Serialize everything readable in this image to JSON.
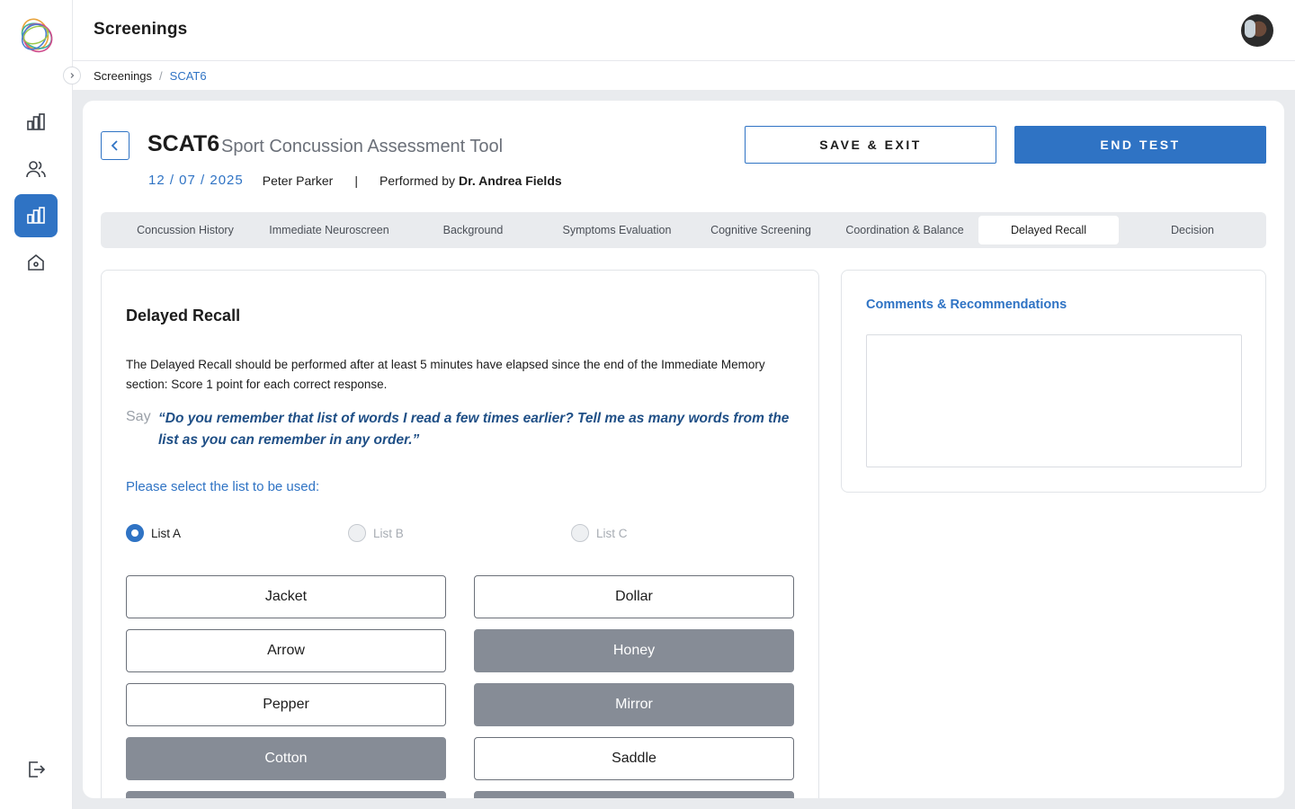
{
  "header": {
    "title": "Screenings"
  },
  "breadcrumb": {
    "root": "Screenings",
    "separator": "/",
    "current": "SCAT6"
  },
  "sidebar": {
    "items": [
      {
        "icon": "bar-chart-icon"
      },
      {
        "icon": "users-icon"
      },
      {
        "icon": "bar-chart-icon",
        "active": true
      },
      {
        "icon": "home-icon"
      }
    ],
    "logout_icon": "logout-icon"
  },
  "test": {
    "code": "SCAT6",
    "name": "Sport Concussion Assessment Tool",
    "date": "12 / 07 / 2025",
    "patient": "Peter Parker",
    "divider": "|",
    "performed_by_label": "Performed by",
    "doctor": "Dr. Andrea Fields"
  },
  "actions": {
    "save_exit": "SAVE & EXIT",
    "end_test": "END TEST"
  },
  "tabs": [
    "Concussion History",
    "Immediate Neuroscreen",
    "Background",
    "Symptoms Evaluation",
    "Cognitive Screening",
    "Coordination & Balance",
    "Delayed Recall",
    "Decision"
  ],
  "active_tab": "Delayed Recall",
  "delayed_recall": {
    "title": "Delayed Recall",
    "instructions": "The Delayed Recall should be performed after at least 5 minutes have elapsed since the end of the Immediate Memory section: Score 1 point for each correct response.",
    "say_label": "Say",
    "say_text": "“Do you remember that list of words I read a few times earlier? Tell me as many words from the list as you can remember in any order.”",
    "select_label": "Please select the list to be used:",
    "lists": [
      {
        "label": "List A",
        "selected": true
      },
      {
        "label": "List B",
        "selected": false
      },
      {
        "label": "List C",
        "selected": false
      }
    ],
    "words": [
      {
        "word": "Jacket",
        "selected": false
      },
      {
        "word": "Dollar",
        "selected": false
      },
      {
        "word": "Arrow",
        "selected": false
      },
      {
        "word": "Honey",
        "selected": true
      },
      {
        "word": "Pepper",
        "selected": false
      },
      {
        "word": "Mirror",
        "selected": true
      },
      {
        "word": "Cotton",
        "selected": true
      },
      {
        "word": "Saddle",
        "selected": false
      }
    ]
  },
  "comments": {
    "title": "Comments & Recommendations",
    "value": ""
  },
  "colors": {
    "accent": "#2f73c4",
    "selected_word": "#868c96",
    "say_text": "#1f4f86"
  }
}
